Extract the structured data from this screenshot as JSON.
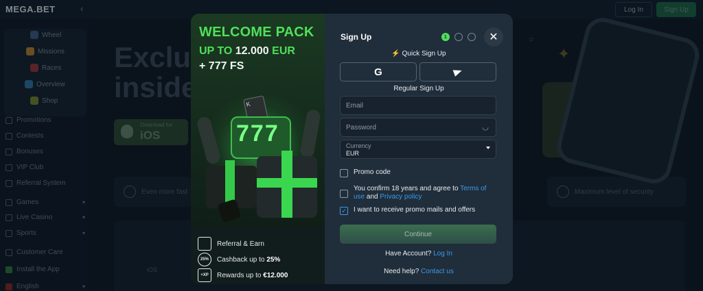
{
  "app": {
    "logo": "MEGA.BET",
    "login_label": "Log In",
    "signup_label": "Sign Up"
  },
  "sidebar": {
    "top_items": [
      {
        "label": "Wheel",
        "icon": "wheel-icon"
      },
      {
        "label": "Missions",
        "icon": "missions-icon"
      },
      {
        "label": "Races",
        "icon": "races-icon"
      },
      {
        "label": "Overview",
        "icon": "overview-icon"
      },
      {
        "label": "Shop",
        "icon": "shop-icon"
      }
    ],
    "items": [
      {
        "label": "Promotions",
        "icon": "promotions-icon"
      },
      {
        "label": "Contests",
        "icon": "contests-icon"
      },
      {
        "label": "Bonuses",
        "icon": "bonuses-icon"
      },
      {
        "label": "VIP Club",
        "icon": "vip-icon"
      },
      {
        "label": "Referral System",
        "icon": "referral-icon"
      },
      {
        "label": "Games",
        "icon": "games-icon"
      },
      {
        "label": "Live Casino",
        "icon": "live-casino-icon"
      },
      {
        "label": "Sports",
        "icon": "sports-icon"
      },
      {
        "label": "Customer Care",
        "icon": "support-icon"
      },
      {
        "label": "Install the App",
        "icon": "app-icon"
      },
      {
        "label": "English",
        "icon": "flag-icon"
      }
    ]
  },
  "background": {
    "hero_line1": "Exclu",
    "hero_line2": "inside",
    "ios_download": "Download for",
    "ios_label": "iOS",
    "feature_left": "Even more fast",
    "feature_right": "Maximum level of security",
    "bottom_ios": "iOS"
  },
  "promo": {
    "title": "WELCOME PACK",
    "sub_prefix": "UP TO",
    "sub_amount": "12.000",
    "sub_currency": "EUR",
    "sub_line2": "+ 777 FS",
    "slot_text": "777",
    "card_text": "K",
    "perks": [
      {
        "label": "Referral & Earn",
        "bold": "",
        "icon": "referral-icon",
        "icon_text": ""
      },
      {
        "label": "Cashback up to",
        "bold": "25%",
        "icon": "cashback-icon",
        "icon_text": "25%"
      },
      {
        "label": "Rewards up to",
        "bold": "€12.000",
        "icon": "xp-icon",
        "icon_text": "+XP"
      }
    ]
  },
  "form": {
    "title": "Sign Up",
    "steps": [
      "1",
      "",
      ""
    ],
    "quick_label": "Quick Sign Up",
    "regular_label": "Regular Sign Up",
    "email_placeholder": "Email",
    "password_placeholder": "Password",
    "currency_label": "Currency",
    "currency_value": "EUR",
    "promo_code": "Promo code",
    "confirm_text": "You confirm 18 years and agree to",
    "terms_link": "Terms of use",
    "and": "and",
    "privacy_link": "Privacy policy",
    "promo_mails": "I want to receive promo mails and offers",
    "continue_label": "Continue",
    "have_account": "Have Account?",
    "login_link": "Log In",
    "need_help": "Need help?",
    "contact_link": "Contact us",
    "checks": {
      "promo_code": false,
      "confirm_age": false,
      "promo_mails": true
    }
  },
  "colors": {
    "accent_green": "#4fe05a",
    "link_blue": "#3b9be8",
    "modal_bg": "#202d3b"
  }
}
